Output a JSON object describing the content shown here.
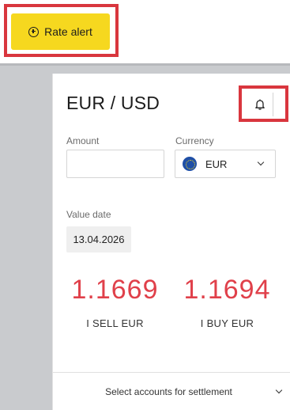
{
  "toolbar": {
    "rate_alert_label": "Rate alert"
  },
  "widget": {
    "pair_title": "EUR / USD",
    "amount": {
      "label": "Amount",
      "value": "",
      "placeholder": ""
    },
    "currency": {
      "label": "Currency",
      "selected": "EUR",
      "flag_icon": "eu-flag-icon"
    },
    "value_date": {
      "label": "Value date",
      "date": "13.04.2026"
    },
    "sell": {
      "rate": "1.1669",
      "caption": "I SELL EUR"
    },
    "buy": {
      "rate": "1.1694",
      "caption": "I BUY EUR"
    },
    "settlement": {
      "label": "Select accounts for settlement"
    }
  },
  "colors": {
    "accent_yellow": "#f6d81f",
    "highlight_red": "#d9363e",
    "rate_red": "#e0404a",
    "backdrop_gray": "#c9cbce"
  },
  "icons": {
    "rate_alert": "plus-circle-icon",
    "bell": "bell-icon",
    "dropdown": "chevron-down-icon"
  }
}
